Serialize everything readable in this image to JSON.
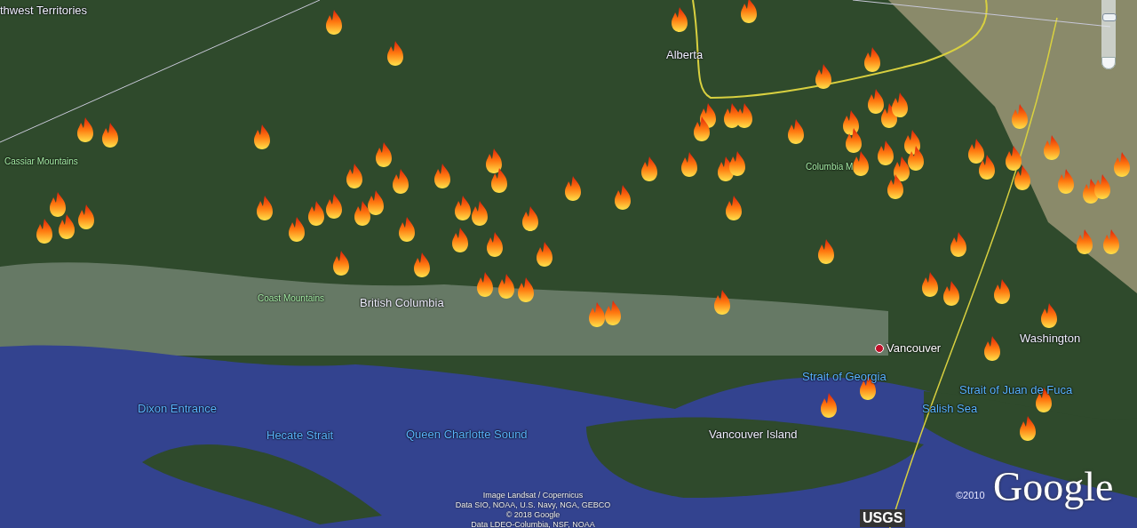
{
  "map_labels": [
    {
      "text": "thwest Territories",
      "kind": "region"
    },
    {
      "text": "Alberta",
      "kind": "region"
    },
    {
      "text": "Cassiar Mountains",
      "kind": "mountain"
    },
    {
      "text": "Columbia M",
      "kind": "mountain"
    },
    {
      "text": "Coast Mountains",
      "kind": "mountain"
    },
    {
      "text": "British Columbia",
      "kind": "region"
    },
    {
      "text": "Vancouver",
      "kind": "city"
    },
    {
      "text": "Washington",
      "kind": "region"
    },
    {
      "text": "Strait of Georgia",
      "kind": "water"
    },
    {
      "text": "Strait of Juan de Fuca",
      "kind": "water"
    },
    {
      "text": "Salish Sea",
      "kind": "water"
    },
    {
      "text": "Dixon Entrance",
      "kind": "water"
    },
    {
      "text": "Hecate Strait",
      "kind": "water"
    },
    {
      "text": "Queen Charlotte Sound",
      "kind": "water"
    },
    {
      "text": "Vancouver Island",
      "kind": "region"
    }
  ],
  "zoom_slider": {
    "level": 0.75
  },
  "attribution": [
    "Image Landsat / Copernicus",
    "Data SIO, NOAA, U.S. Navy, NGA, GEBCO",
    "© 2018 Google",
    "Data LDEO-Columbia, NSF, NOAA"
  ],
  "copyright_year": "©2010",
  "logo": "Google",
  "usgs_logo": "USGS"
}
